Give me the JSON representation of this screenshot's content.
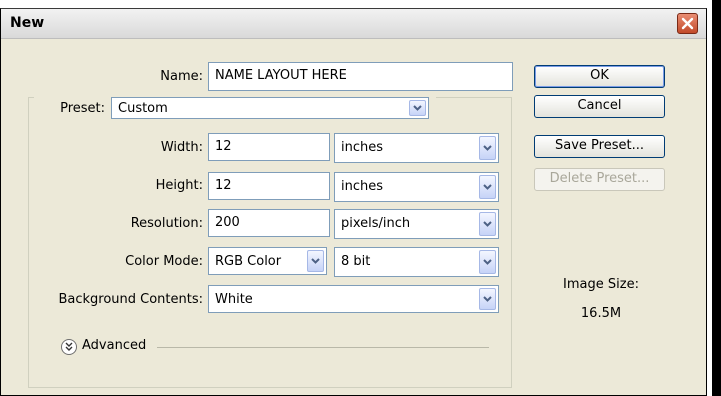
{
  "dialog": {
    "title": "New"
  },
  "form": {
    "name_label": "Name:",
    "name_value": "NAME LAYOUT HERE",
    "preset_label": "Preset:",
    "preset_value": "Custom",
    "width_label": "Width:",
    "width_value": "12",
    "width_unit": "inches",
    "height_label": "Height:",
    "height_value": "12",
    "height_unit": "inches",
    "resolution_label": "Resolution:",
    "resolution_value": "200",
    "resolution_unit": "pixels/inch",
    "color_mode_label": "Color Mode:",
    "color_mode_value": "RGB Color",
    "bit_depth_value": "8 bit",
    "background_label": "Background Contents:",
    "background_value": "White",
    "advanced_label": "Advanced"
  },
  "buttons": {
    "ok": "OK",
    "cancel": "Cancel",
    "save_preset": "Save Preset...",
    "delete_preset": "Delete Preset..."
  },
  "info": {
    "image_size_label": "Image Size:",
    "image_size_value": "16.5M"
  },
  "icons": {
    "close": "close-icon",
    "dropdown": "chevron-down-icon",
    "advanced": "double-chevron-down-icon"
  },
  "colors": {
    "dialog_bg": "#ece9d8",
    "close_button": "#c24a2a",
    "button_border": "#003c74",
    "field_border": "#7f9db9"
  }
}
